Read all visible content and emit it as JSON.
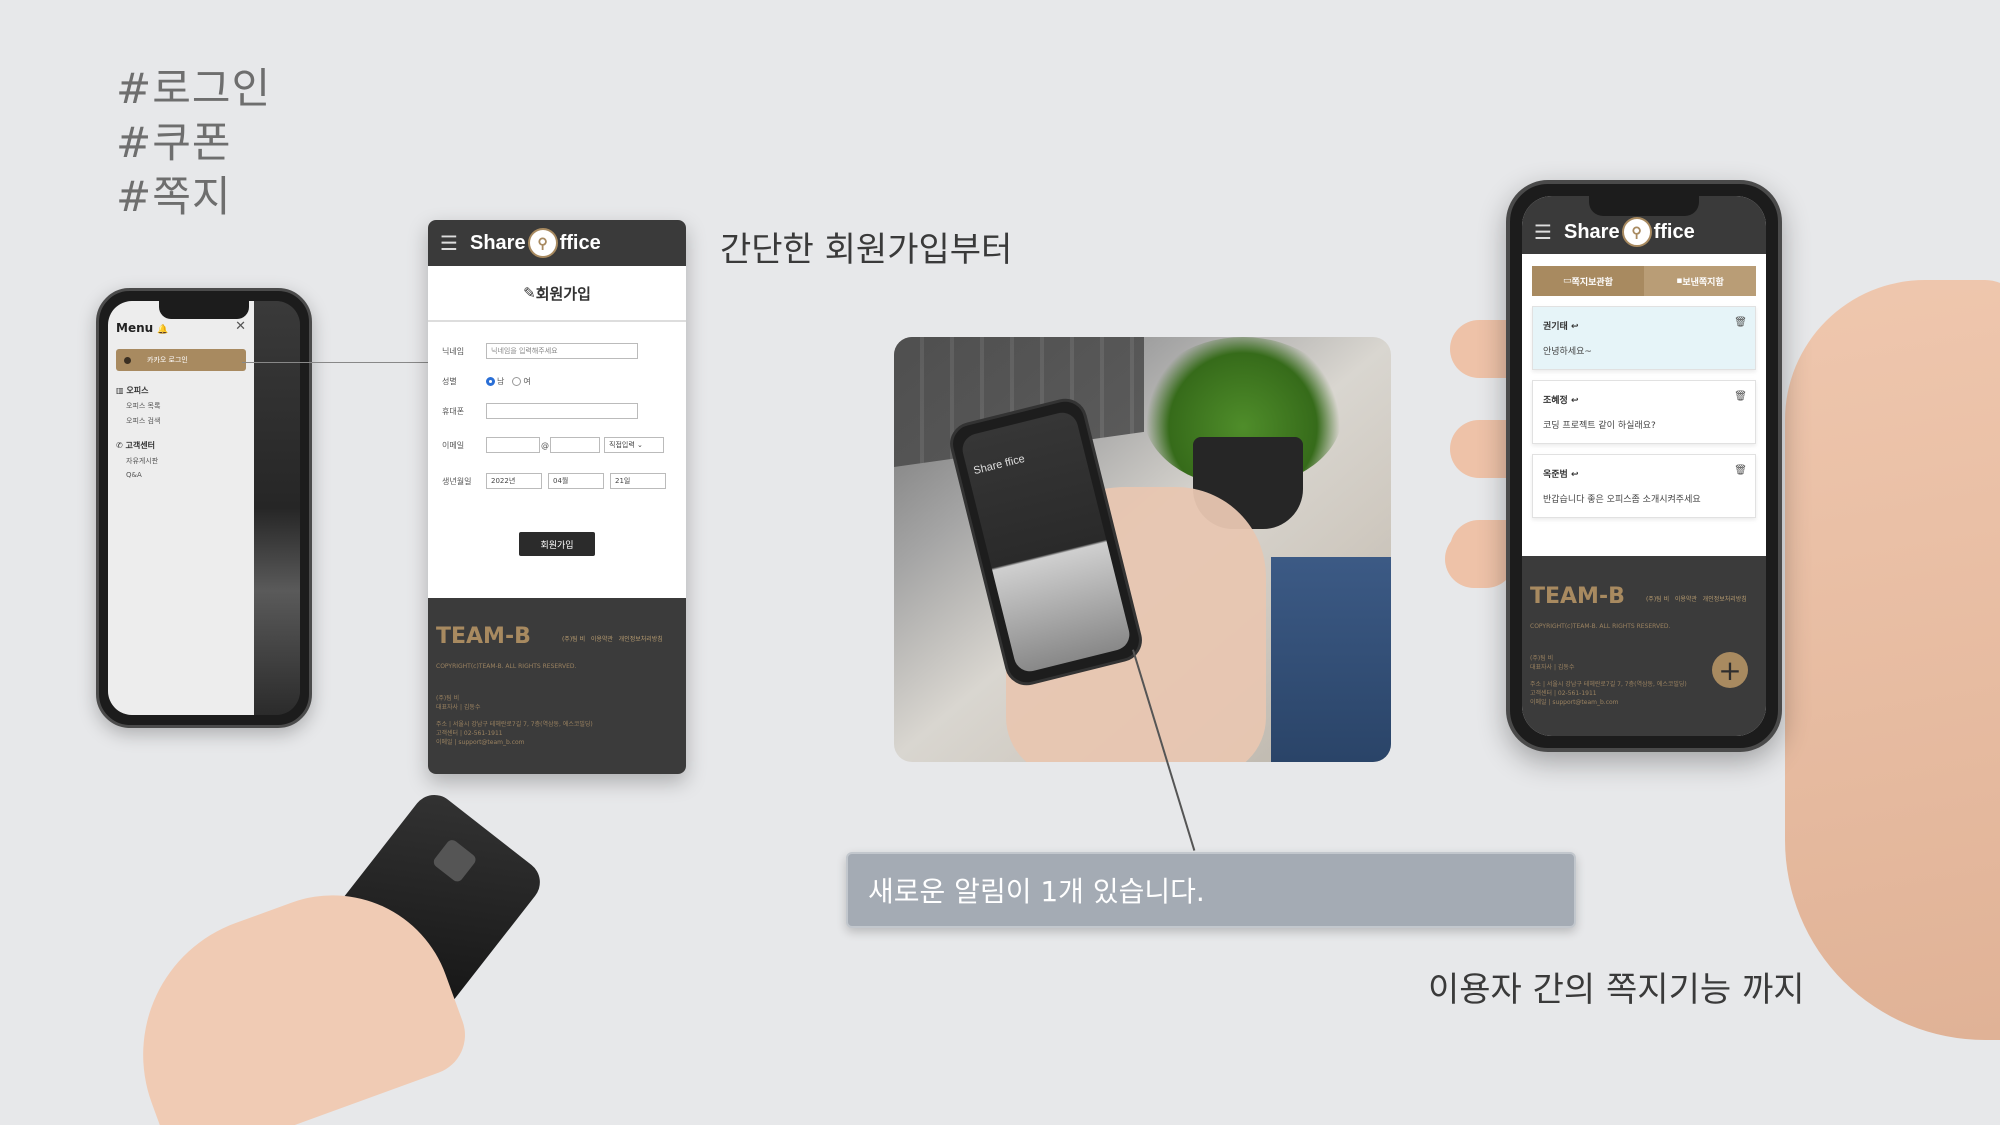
{
  "tags": [
    "#로그인",
    "#쿠폰",
    "#쪽지"
  ],
  "captions": {
    "signup": "간단한 회원가입부터",
    "message": "이용자 간의 쪽지기능 까지"
  },
  "toast": "새로운 알림이 1개 있습니다.",
  "brand": {
    "left": "Share",
    "right": "ffice"
  },
  "menu": {
    "title": "Menu",
    "close": "✕",
    "login_button": "카카오 로그인",
    "sections": [
      {
        "title": "오피스",
        "items": [
          "오피스 목록",
          "오피스 검색"
        ]
      },
      {
        "title": "고객센터",
        "items": [
          "자유게시판",
          "Q&A"
        ]
      }
    ]
  },
  "signup": {
    "title": "회원가입",
    "fields": {
      "nickname_label": "닉네임",
      "nickname_placeholder": "닉네임을 입력해주세요",
      "gender_label": "성별",
      "gender_male": "남",
      "gender_female": "여",
      "phone_label": "휴대폰",
      "email_label": "이메일",
      "email_at": "@",
      "email_domain": "직접입력",
      "birth_label": "생년월일",
      "birth_year": "2022년",
      "birth_month": "04월",
      "birth_day": "21일"
    },
    "submit": "회원가입"
  },
  "footer": {
    "team": "TEAM-B",
    "links": [
      "(주)팀 비",
      "이용약관",
      "개인정보처리방침"
    ],
    "copyright": "COPYRIGHT(c)TEAM-B. ALL RIGHTS RESERVED.",
    "company": "(주)팀 비",
    "ceo": "대표자사 | 김동수",
    "address": "주소 | 서울시 강남구 테헤란로7길 7, 7층(역삼동, 에스코빌딩)",
    "tel": "고객센터 | 02-561-1911",
    "email": "이메일 | support@team_b.com"
  },
  "messages": {
    "tabs": [
      "쪽지보관함",
      "보낸쪽지함"
    ],
    "items": [
      {
        "name": "권기태",
        "text": "안녕하세요~"
      },
      {
        "name": "조혜정",
        "text": "코딩 프로젝트 같이 하실래요?"
      },
      {
        "name": "옥준범",
        "text": "반갑습니다 좋은 오피스좀 소개시켜주세요"
      }
    ],
    "fab": "+"
  },
  "colors": {
    "accent": "#a88a60",
    "dark": "#3a3a3a",
    "toast": "#a4abb4",
    "background": "#e7e8ea"
  }
}
